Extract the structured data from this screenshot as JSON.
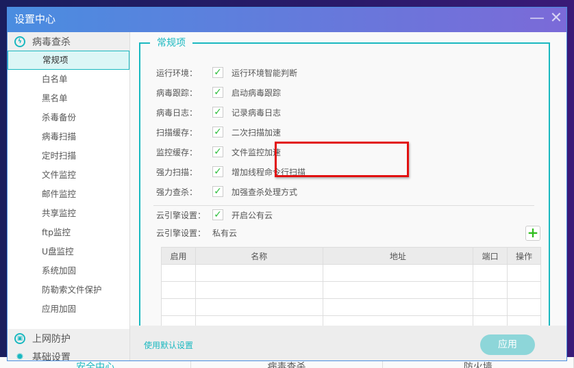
{
  "background_app": {
    "tabs": [
      "安全中心",
      "病毒查杀",
      "防火墙"
    ]
  },
  "window": {
    "title": "设置中心",
    "minimize_icon": "minimize-icon",
    "close_icon": "close-icon"
  },
  "sidebar": {
    "virus": {
      "label": "病毒查杀",
      "icon": "virus-scan-icon",
      "items": [
        "常规项",
        "白名单",
        "黑名单",
        "杀毒备份",
        "病毒扫描",
        "定时扫描",
        "文件监控",
        "邮件监控",
        "共享监控",
        "ftp监控",
        "U盘监控",
        "系统加固",
        "防勒索文件保护",
        "应用加固"
      ],
      "selected": "常规项"
    },
    "web": {
      "label": "上网防护",
      "icon": "web-protection-icon"
    },
    "basic": {
      "label": "基础设置",
      "icon": "gear-icon"
    }
  },
  "general": {
    "title": "常规项",
    "rows": [
      {
        "label": "运行环境：",
        "checked": true,
        "text": "运行环境智能判断"
      },
      {
        "label": "病毒跟踪：",
        "checked": true,
        "text": "启动病毒跟踪"
      },
      {
        "label": "病毒日志：",
        "checked": true,
        "text": "记录病毒日志"
      },
      {
        "label": "扫描缓存：",
        "checked": true,
        "text": "二次扫描加速"
      },
      {
        "label": "监控缓存：",
        "checked": true,
        "text": "文件监控加速"
      },
      {
        "label": "强力扫描：",
        "checked": true,
        "text": "增加线程命令行扫描"
      },
      {
        "label": "强力查杀：",
        "checked": true,
        "text": "加强查杀处理方式"
      }
    ],
    "public_cloud": {
      "label": "云引擎设置：",
      "checked": true,
      "text": "开启公有云"
    },
    "private_cloud": {
      "label": "云引擎设置：",
      "text": "私有云"
    },
    "table": {
      "headers": [
        "启用",
        "名称",
        "地址",
        "端口",
        "操作"
      ],
      "rows": []
    }
  },
  "footer": {
    "default_link": "使用默认设置",
    "apply": "应用"
  },
  "colors": {
    "accent": "#19b8c0",
    "highlight": "#e21010",
    "check": "#2fbe3e"
  }
}
